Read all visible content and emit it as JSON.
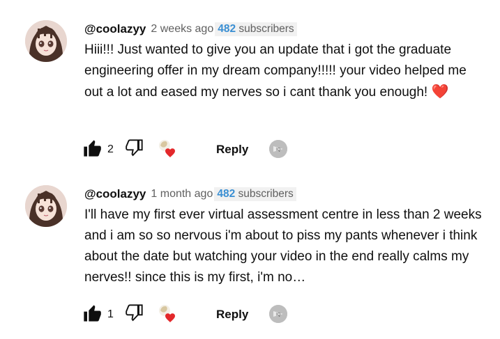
{
  "comments": [
    {
      "author": "@coolazyy",
      "time": "2 weeks ago",
      "subscribers_count": "482",
      "subscribers_label": "subscribers",
      "text": "Hiii!!! Just wanted to give you an update that i got the graduate engineering offer in my dream company!!!!! your video helped me out a lot and eased my nerves so i cant thank you enough!",
      "emoji": "❤️",
      "likes": "2",
      "reply_label": "Reply"
    },
    {
      "author": "@coolazyy",
      "time": "1 month ago",
      "subscribers_count": "482",
      "subscribers_label": "subscribers",
      "text": "I'll have my first ever virtual assessment centre in less than 2 weeks and i am so so nervous i'm about to piss my pants whenever i think about the date but watching your video in the end really calms my nerves!! since this is my first, i'm no…",
      "likes": "1",
      "reply_label": "Reply"
    }
  ],
  "badge_text": "IQ",
  "colors": {
    "accent_blue": "#3a8fd3",
    "heart_red": "#e3282b",
    "muted": "#606060"
  }
}
